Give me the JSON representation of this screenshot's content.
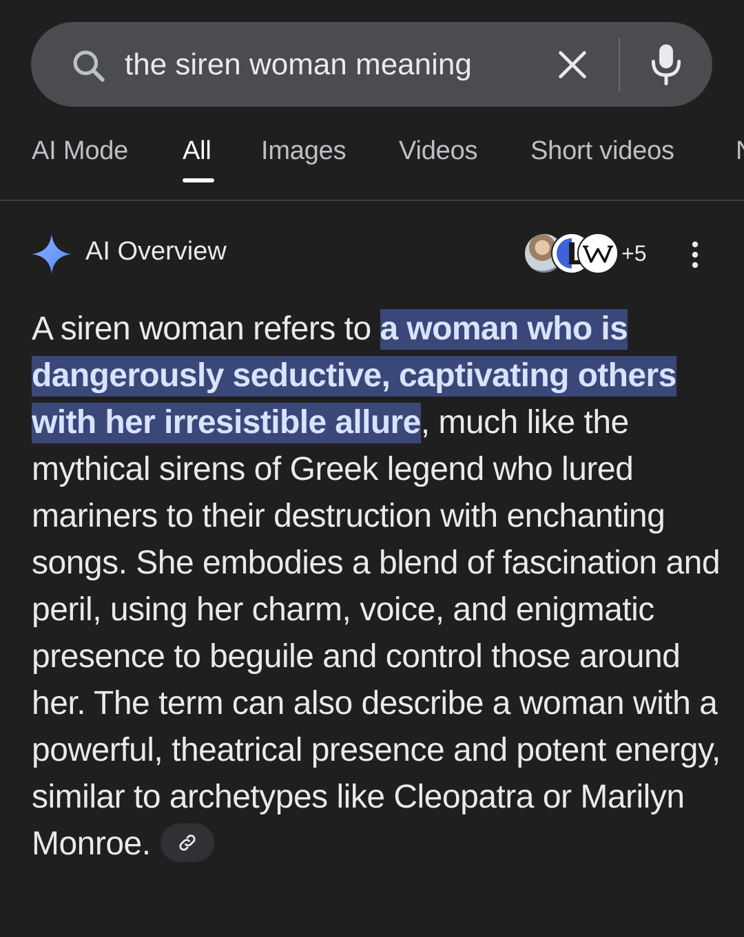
{
  "search": {
    "query": "the siren woman meaning",
    "icons": {
      "search": "search-icon",
      "clear": "close-icon",
      "voice": "mic-icon"
    }
  },
  "tabs": [
    {
      "label": "AI Mode",
      "active": false
    },
    {
      "label": "All",
      "active": true
    },
    {
      "label": "Images",
      "active": false
    },
    {
      "label": "Videos",
      "active": false
    },
    {
      "label": "Short videos",
      "active": false
    },
    {
      "label": "N",
      "active": false
    }
  ],
  "ai_overview": {
    "title": "AI Overview",
    "sources_more": "+5",
    "answer": {
      "before_highlight": "A siren woman refers to ",
      "highlight": "a woman who is dangerously seductive, captivating others with her irresistible allure",
      "after_highlight": ", much like the mythical sirens of Greek legend who lured mariners to their destruction with enchanting songs. She embodies a blend of fascination and peril, using her charm, voice, and enigmatic presence to beguile and control those around her. The term can also describe a woman with a powerful, theatrical presence and potent energy, similar to archetypes like Cleopatra or Marilyn Monroe."
    }
  },
  "colors": {
    "background": "#1f1f1f",
    "search_bar": "#4a4c50",
    "highlight_bg": "#394879",
    "highlight_text": "#d9e2ff",
    "sparkle": "#6f9cff"
  }
}
